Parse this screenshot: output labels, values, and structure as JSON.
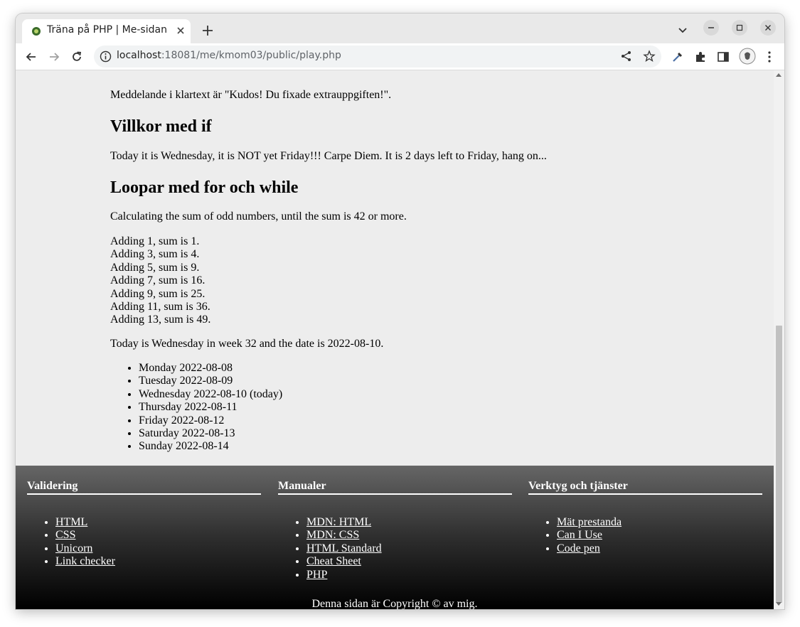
{
  "browser": {
    "tab_title": "Träna på PHP | Me-sidan",
    "url_host": "localhost",
    "url_rest": ":18081/me/kmom03/public/play.php"
  },
  "page": {
    "message_line": "Meddelande i klartext är \"Kudos! Du fixade extrauppgiften!\".",
    "heading_if": "Villkor med if",
    "friday_text": "Today it is Wednesday, it is NOT yet Friday!!! Carpe Diem. It is 2 days left to Friday, hang on...",
    "heading_loops": "Loopar med for och while",
    "calc_intro": "Calculating the sum of odd numbers, until the sum is 42 or more.",
    "adding_lines": [
      "Adding 1, sum is 1.",
      "Adding 3, sum is 4.",
      "Adding 5, sum is 9.",
      "Adding 7, sum is 16.",
      "Adding 9, sum is 25.",
      "Adding 11, sum is 36.",
      "Adding 13, sum is 49."
    ],
    "week_text": "Today is Wednesday in week 32 and the date is 2022-08-10.",
    "days": [
      "Monday 2022-08-08",
      "Tuesday 2022-08-09",
      "Wednesday 2022-08-10 (today)",
      "Thursday 2022-08-11",
      "Friday 2022-08-12",
      "Saturday 2022-08-13",
      "Sunday 2022-08-14"
    ]
  },
  "footer": {
    "columns": [
      {
        "heading": "Validering",
        "links": [
          "HTML",
          "CSS",
          "Unicorn",
          "Link checker"
        ]
      },
      {
        "heading": "Manualer",
        "links": [
          "MDN: HTML",
          "MDN: CSS",
          "HTML Standard",
          "Cheat Sheet",
          "PHP"
        ]
      },
      {
        "heading": "Verktyg och tjänster",
        "links": [
          "Mät prestanda",
          "Can I Use",
          "Code pen"
        ]
      }
    ],
    "copyright": "Denna sidan är Copyright © av mig."
  }
}
